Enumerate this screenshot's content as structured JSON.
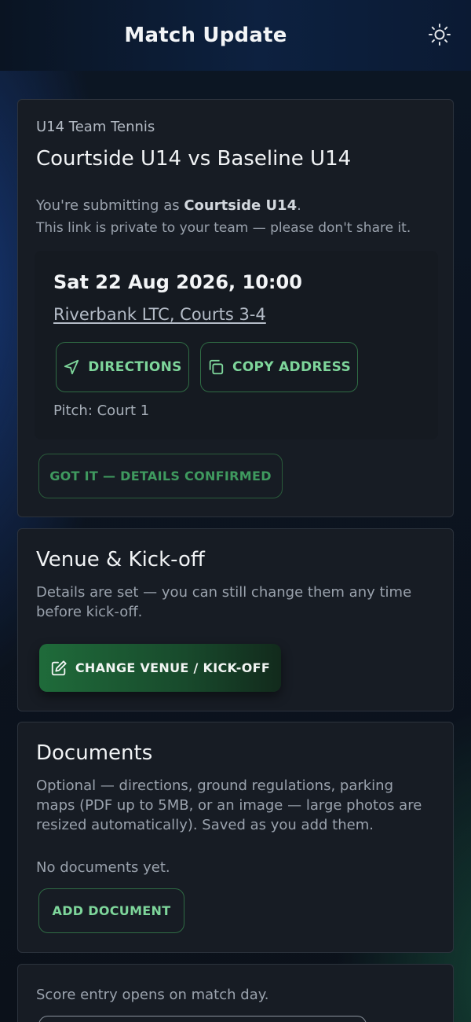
{
  "header": {
    "title": "Match Update",
    "theme_icon": "sun-icon"
  },
  "match": {
    "competition": "U14 Team Tennis",
    "title": "Courtside U14 vs Baseline U14",
    "submitting_prefix": "You're submitting as ",
    "submitting_team": "Courtside U14",
    "submitting_suffix": ".",
    "privacy_note": "This link is private to your team — please don't share it.",
    "datetime": "Sat 22 Aug 2026, 10:00",
    "venue": "Riverbank LTC, Courts 3-4",
    "directions_label": "DIRECTIONS",
    "copy_address_label": "COPY ADDRESS",
    "pitch": "Pitch: Court 1",
    "confirm_label": "GOT IT — DETAILS CONFIRMED"
  },
  "venue_section": {
    "title": "Venue & Kick-off",
    "description": "Details are set — you can still change them any time before kick-off.",
    "change_label": "CHANGE VENUE / KICK-OFF"
  },
  "documents": {
    "title": "Documents",
    "description": "Optional — directions, ground regulations, parking maps (PDF up to 5MB, or an image — large photos are resized automatically). Saved as you add them.",
    "empty": "No documents yet.",
    "add_label": "ADD DOCUMENT"
  },
  "score": {
    "note": "Score entry opens on match day."
  },
  "colors": {
    "accent": "#7ed69b",
    "accent_border": "#2f6b44",
    "card": "#171c24",
    "primary_btn": "#1f6b3a"
  }
}
